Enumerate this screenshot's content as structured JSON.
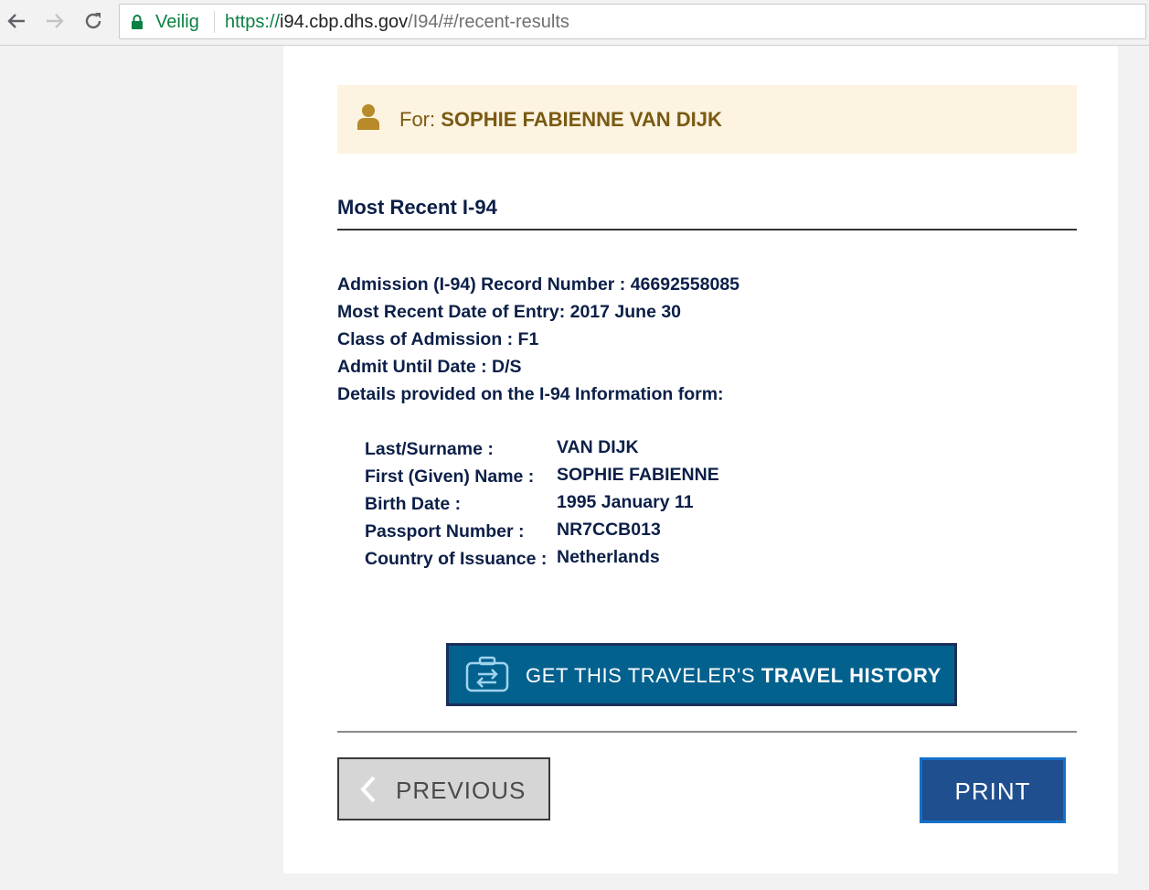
{
  "browser": {
    "secure_label": "Veilig",
    "url_scheme": "https://",
    "url_host": "i94.cbp.dhs.gov",
    "url_path": "/I94/#/recent-results"
  },
  "banner": {
    "for_label": "For:",
    "traveler_name": "SOPHIE FABIENNE VAN DIJK"
  },
  "section_title": "Most Recent I-94",
  "record": {
    "admission_number": "Admission (I-94) Record Number : 46692558085",
    "recent_entry": "Most Recent Date of Entry: 2017 June 30",
    "class_of_admission": "Class of Admission : F1",
    "admit_until": "Admit Until Date : D/S",
    "details_intro": "Details provided on the I-94 Information form:"
  },
  "details": [
    {
      "label": "Last/Surname :",
      "value": "VAN DIJK"
    },
    {
      "label": "First (Given) Name :",
      "value": "SOPHIE FABIENNE"
    },
    {
      "label": "Birth Date :",
      "value": "1995 January 11"
    },
    {
      "label": "Passport Number :",
      "value": "NR7CCB013"
    },
    {
      "label": "Country of Issuance :",
      "value": "Netherlands"
    }
  ],
  "travel_history_button": {
    "prefix": "GET THIS TRAVELER'S",
    "emphasis": "TRAVEL HISTORY"
  },
  "previous_button": "PREVIOUS",
  "print_button": "PRINT",
  "icons": {
    "back": "arrow-left-icon",
    "forward": "arrow-right-icon",
    "reload": "reload-icon",
    "secure": "lock-icon",
    "traveler": "person-icon",
    "travel_history": "briefcase-swap-icon",
    "previous": "chevron-left-icon"
  },
  "colors": {
    "banner_bg": "#fdf3e1",
    "banner_text": "#7a5a12",
    "navy_text": "#0c1f48",
    "travel_button": "#03618e",
    "print_button": "#1f4f8f",
    "secure_green": "#0b8043"
  }
}
